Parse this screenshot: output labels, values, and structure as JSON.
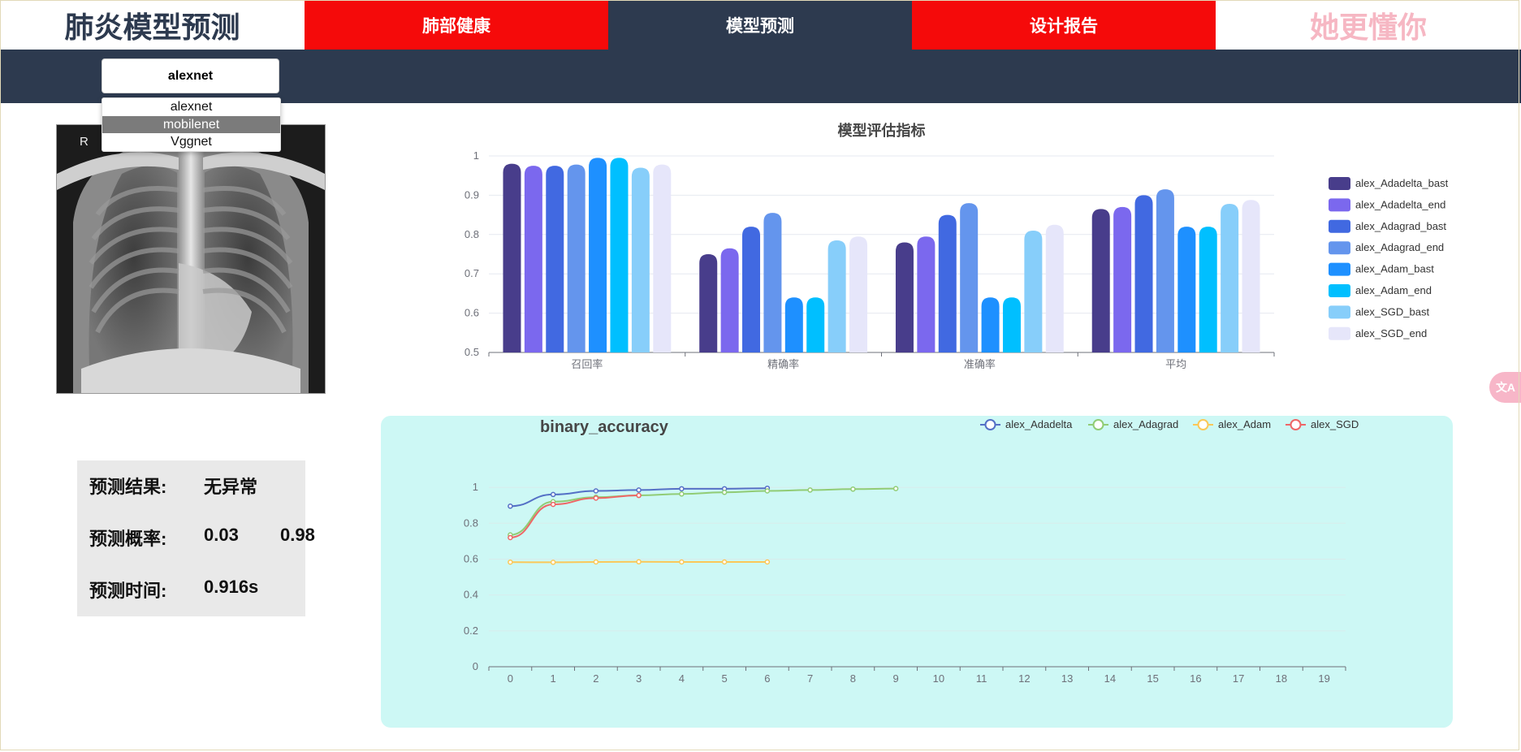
{
  "header": {
    "brand": "肺炎模型预测",
    "tabs": [
      {
        "label": "肺部健康",
        "active": false
      },
      {
        "label": "模型预测",
        "active": true
      },
      {
        "label": "设计报告",
        "active": false
      }
    ],
    "slogan": "她更懂你"
  },
  "model_select": {
    "selected": "alexnet",
    "options": [
      "alexnet",
      "mobilenet",
      "Vggnet"
    ],
    "highlighted": "mobilenet"
  },
  "xray": {
    "marker": "R"
  },
  "result": {
    "result_label": "预测结果:",
    "result_value": "无异常",
    "prob_label": "预测概率:",
    "prob_value_1": "0.03",
    "prob_value_2": "0.98",
    "time_label": "预测时间:",
    "time_value": "0.916s"
  },
  "translate_icon": "translate-icon",
  "chart_data": [
    {
      "type": "bar",
      "title": "模型评估指标",
      "categories": [
        "召回率",
        "精确率",
        "准确率",
        "平均"
      ],
      "ylim": [
        0.5,
        1
      ],
      "yticks": [
        0.5,
        0.6,
        0.7,
        0.8,
        0.9,
        1
      ],
      "legend_position": "right",
      "series": [
        {
          "name": "alex_Adadelta_bast",
          "color": "#483d8b",
          "values": [
            0.98,
            0.75,
            0.78,
            0.865
          ]
        },
        {
          "name": "alex_Adadelta_end",
          "color": "#7b68ee",
          "values": [
            0.975,
            0.765,
            0.795,
            0.87
          ]
        },
        {
          "name": "alex_Adagrad_bast",
          "color": "#4169e1",
          "values": [
            0.975,
            0.82,
            0.85,
            0.9
          ]
        },
        {
          "name": "alex_Adagrad_end",
          "color": "#6495ed",
          "values": [
            0.978,
            0.855,
            0.88,
            0.915
          ]
        },
        {
          "name": "alex_Adam_bast",
          "color": "#1e90ff",
          "values": [
            0.995,
            0.64,
            0.64,
            0.82
          ]
        },
        {
          "name": "alex_Adam_end",
          "color": "#00bfff",
          "values": [
            0.995,
            0.64,
            0.64,
            0.82
          ]
        },
        {
          "name": "alex_SGD_bast",
          "color": "#87cefa",
          "values": [
            0.97,
            0.785,
            0.81,
            0.878
          ]
        },
        {
          "name": "alex_SGD_end",
          "color": "#e6e6fa",
          "values": [
            0.978,
            0.795,
            0.825,
            0.888
          ]
        }
      ]
    },
    {
      "type": "line",
      "title": "binary_accuracy",
      "x": [
        0,
        1,
        2,
        3,
        4,
        5,
        6,
        7,
        8,
        9,
        10,
        11,
        12,
        13,
        14,
        15,
        16,
        17,
        18,
        19
      ],
      "ylim": [
        0,
        1.1
      ],
      "yticks": [
        0,
        0.2,
        0.4,
        0.6,
        0.8,
        1
      ],
      "legend_position": "top-right",
      "series": [
        {
          "name": "alex_Adadelta",
          "color": "#5470c6",
          "values": [
            0.895,
            0.96,
            0.98,
            0.985,
            0.992,
            0.992,
            0.995
          ]
        },
        {
          "name": "alex_Adagrad",
          "color": "#91cc75",
          "values": [
            0.735,
            0.92,
            0.945,
            0.955,
            0.963,
            0.972,
            0.98,
            0.985,
            0.99,
            0.993
          ]
        },
        {
          "name": "alex_Adam",
          "color": "#fac858",
          "values": [
            0.583,
            0.582,
            0.584,
            0.585,
            0.584,
            0.584,
            0.584
          ]
        },
        {
          "name": "alex_SGD",
          "color": "#ee6666",
          "values": [
            0.72,
            0.905,
            0.94,
            0.955
          ]
        }
      ]
    }
  ]
}
